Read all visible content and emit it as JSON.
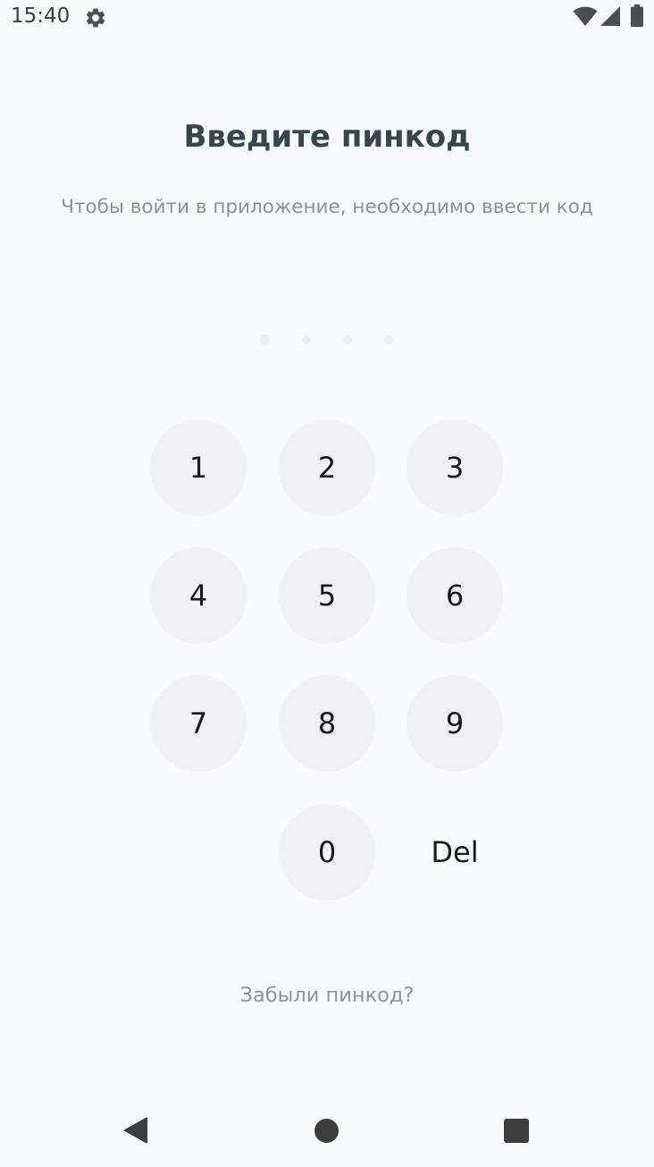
{
  "status_bar": {
    "time": "15:40",
    "icons": [
      "gear-icon",
      "wifi-icon",
      "signal-icon",
      "battery-icon"
    ]
  },
  "header": {
    "title": "Введите пинкод",
    "subtitle": "Чтобы войти в приложение, необходимо ввести код"
  },
  "pin": {
    "length": 4,
    "entered": 0
  },
  "keypad": {
    "keys": [
      "1",
      "2",
      "3",
      "4",
      "5",
      "6",
      "7",
      "8",
      "9",
      "0"
    ],
    "delete_label": "Del"
  },
  "forgot_link": "Забыли пинкод?",
  "nav_bar": {
    "icons": [
      "back-icon",
      "home-icon",
      "recents-icon"
    ]
  },
  "colors": {
    "background": "#f8f9fb",
    "title": "#34474f",
    "muted_text": "#8c9196",
    "key_background": "#f1f1f4",
    "pin_dot": "#ebedf0"
  }
}
